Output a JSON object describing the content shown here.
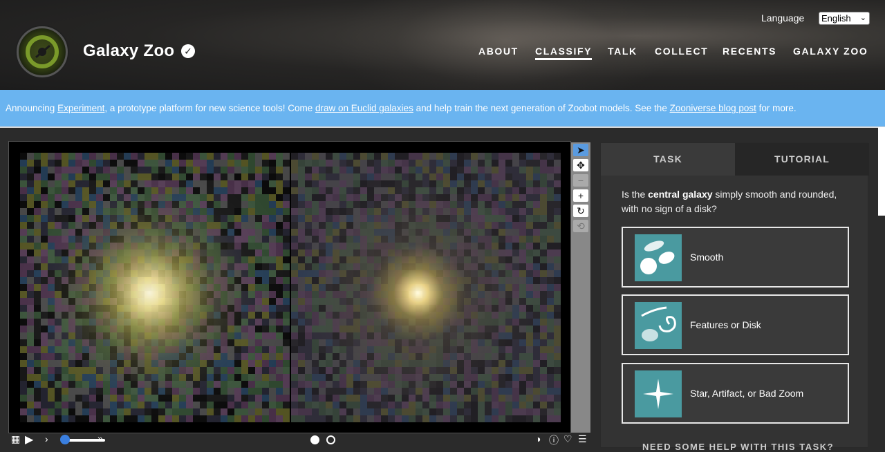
{
  "header": {
    "site_title": "Galaxy Zoo",
    "language_label": "Language",
    "language_value": "English",
    "nav": [
      {
        "label": "ABOUT",
        "active": false
      },
      {
        "label": "CLASSIFY",
        "active": true
      },
      {
        "label": "TALK",
        "active": false
      },
      {
        "label": "COLLECT",
        "active": false
      },
      {
        "label": "RECENTS",
        "active": false
      },
      {
        "label": "GALAXY ZOO",
        "active": false
      }
    ]
  },
  "banner": {
    "t1": "Announcing ",
    "l1": "Experiment",
    "t2": ", a prototype platform for new science tools! Come ",
    "l2": "draw on Euclid galaxies",
    "t3": " and help train the next generation of Zoobot models. See the ",
    "l3": "Zooniverse blog post",
    "t4": " for more."
  },
  "viewer": {
    "tools": [
      "pointer-icon",
      "move-icon",
      "zoom-out-icon",
      "zoom-in-icon",
      "rotate-icon",
      "reset-icon"
    ],
    "controls": [
      "grid-icon",
      "play-icon",
      "contrast-icon",
      "info-icon",
      "favorite-icon",
      "collections-icon"
    ],
    "frame_count": 2,
    "current_frame": 1
  },
  "task": {
    "tab_task": "TASK",
    "tab_tutorial": "TUTORIAL",
    "q_pre": "Is the ",
    "q_bold": "central galaxy",
    "q_post": " simply smooth and rounded, with no sign of a disk?",
    "answers": [
      {
        "label": "Smooth"
      },
      {
        "label": "Features or Disk"
      },
      {
        "label": "Star, Artifact, or Bad Zoom"
      }
    ],
    "help": "NEED SOME HELP WITH THIS TASK?"
  },
  "colors": {
    "banner": "#6ab4f0",
    "accent": "#3a7fe0",
    "answer_thumb": "#4a9aa0"
  }
}
